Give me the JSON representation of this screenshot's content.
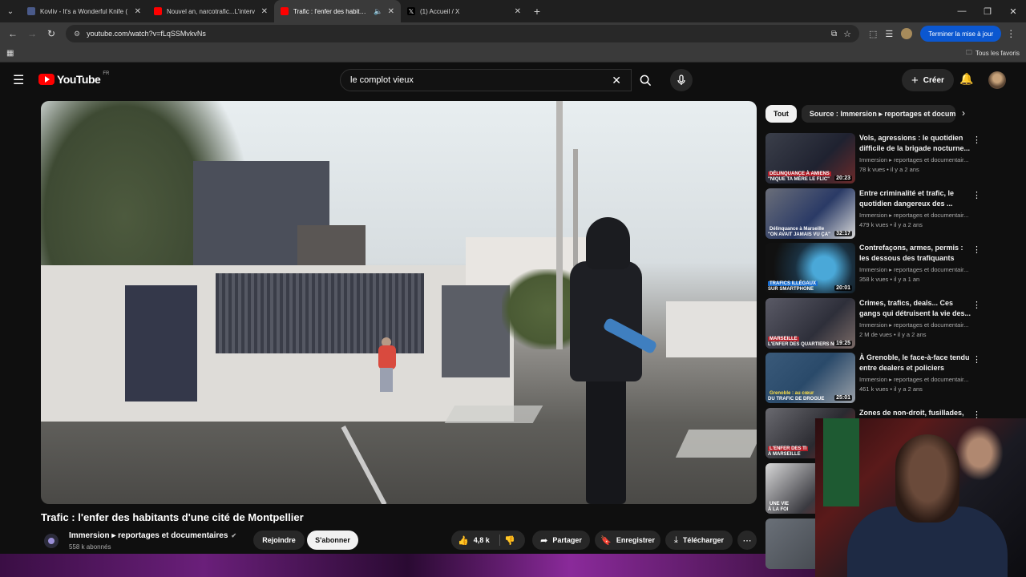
{
  "browser": {
    "tabs": [
      {
        "title": "Kovliv - It's a Wonderful Knife (",
        "favicon_color": "#4a5a8a",
        "active": false
      },
      {
        "title": "Nouvel an, narcotrafic...L'interv",
        "favicon_color": "#ff0000",
        "active": false
      },
      {
        "title": "Trafic : l'enfer des habitants",
        "favicon_color": "#ff0000",
        "active": true
      },
      {
        "title": "(1) Accueil / X",
        "favicon_color": "#000000",
        "active": false
      }
    ],
    "url": "youtube.com/watch?v=fLqSSMvkvNs",
    "update_label": "Terminer la mise à jour",
    "bookmarks_label": "Tous les favoris"
  },
  "youtube": {
    "logo_text": "YouTube",
    "logo_country": "FR",
    "search_value": "le complot vieux",
    "create_label": "Créer"
  },
  "video": {
    "title": "Trafic : l'enfer des habitants d'une cité de Montpellier",
    "channel": "Immersion ▸ reportages et documentaires",
    "verified_icon": "✔",
    "subscribers": "558 k abonnés",
    "join_label": "Rejoindre",
    "subscribe_label": "S'abonner",
    "likes": "4,8 k",
    "share_label": "Partager",
    "save_label": "Enregistrer",
    "download_label": "Télécharger"
  },
  "sidebar": {
    "chips": [
      "Tout",
      "Source : Immersion ▸ reportages et documentaires"
    ],
    "recommendations": [
      {
        "title": "Vols, agressions : le quotidien difficile de la brigade nocturne...",
        "channel": "Immersion ▸ reportages et documentair...",
        "meta": "78 k vues • il y a 2 ans",
        "duration": "20:23",
        "cap1": "DÉLINQUANCE À AMIENS",
        "cap2": "\"NIQUE TA MÈRE LE FLIC\""
      },
      {
        "title": "Entre criminalité et trafic, le quotidien dangereux des ...",
        "channel": "Immersion ▸ reportages et documentair...",
        "meta": "479 k vues • il y a 2 ans",
        "duration": "32:17",
        "cap1": "Délinquance à Marseille",
        "cap2": "\"ON AVAIT JAMAIS VU ÇA\""
      },
      {
        "title": "Contrefaçons, armes, permis : les dessous des trafiquants",
        "channel": "Immersion ▸ reportages et documentair...",
        "meta": "358 k vues • il y a 1 an",
        "duration": "20:01",
        "cap1": "TRAFICS ILLÉGAUX",
        "cap2": "SUR SMARTPHONE"
      },
      {
        "title": "Crimes, trafics, deals... Ces gangs qui détruisent la vie des...",
        "channel": "Immersion ▸ reportages et documentair...",
        "meta": "2 M de vues • il y a 2 ans",
        "duration": "19:25",
        "cap1": "MARSEILLE",
        "cap2": "L'ENFER DES QUARTIERS NO"
      },
      {
        "title": "À Grenoble, le face-à-face tendu entre dealers et policiers",
        "channel": "Immersion ▸ reportages et documentair...",
        "meta": "461 k vues • il y a 2 ans",
        "duration": "25:01",
        "cap1": "Grenoble : au cœur",
        "cap2": "DU TRAFIC DE DROGUE"
      },
      {
        "title": "Zones de non-droit, fusillades,",
        "channel": "",
        "meta": "",
        "duration": "",
        "cap1": "L'ENFER DES TI",
        "cap2": "À MARSEILLE"
      },
      {
        "title": "",
        "channel": "",
        "meta": "",
        "duration": "",
        "cap1": "UNE VIE",
        "cap2": "À LA FOI"
      },
      {
        "title": "",
        "channel": "",
        "meta": "",
        "duration": "",
        "cap1": "",
        "cap2": ""
      }
    ]
  }
}
